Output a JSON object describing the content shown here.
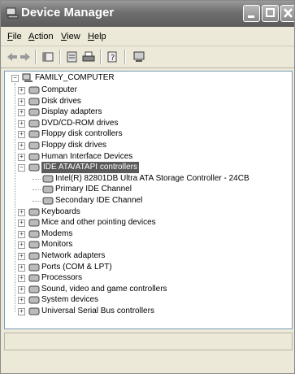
{
  "window": {
    "title": "Device Manager"
  },
  "menu": {
    "file": "File",
    "action": "Action",
    "view": "View",
    "help": "Help"
  },
  "tree": {
    "root": "FAMILY_COMPUTER",
    "items": [
      "Computer",
      "Disk drives",
      "Display adapters",
      "DVD/CD-ROM drives",
      "Floppy disk controllers",
      "Floppy disk drives",
      "Human Interface Devices",
      "IDE ATA/ATAPI controllers",
      "Keyboards",
      "Mice and other pointing devices",
      "Modems",
      "Monitors",
      "Network adapters",
      "Ports (COM & LPT)",
      "Processors",
      "Sound, video and game controllers",
      "System devices",
      "Universal Serial Bus controllers"
    ],
    "ide_children": [
      "Intel(R) 82801DB Ultra ATA Storage Controller - 24CB",
      "Primary IDE Channel",
      "Secondary IDE Channel"
    ]
  },
  "colors": {
    "selection": "#5a5a5a",
    "tree_border": "#7f9db9"
  }
}
